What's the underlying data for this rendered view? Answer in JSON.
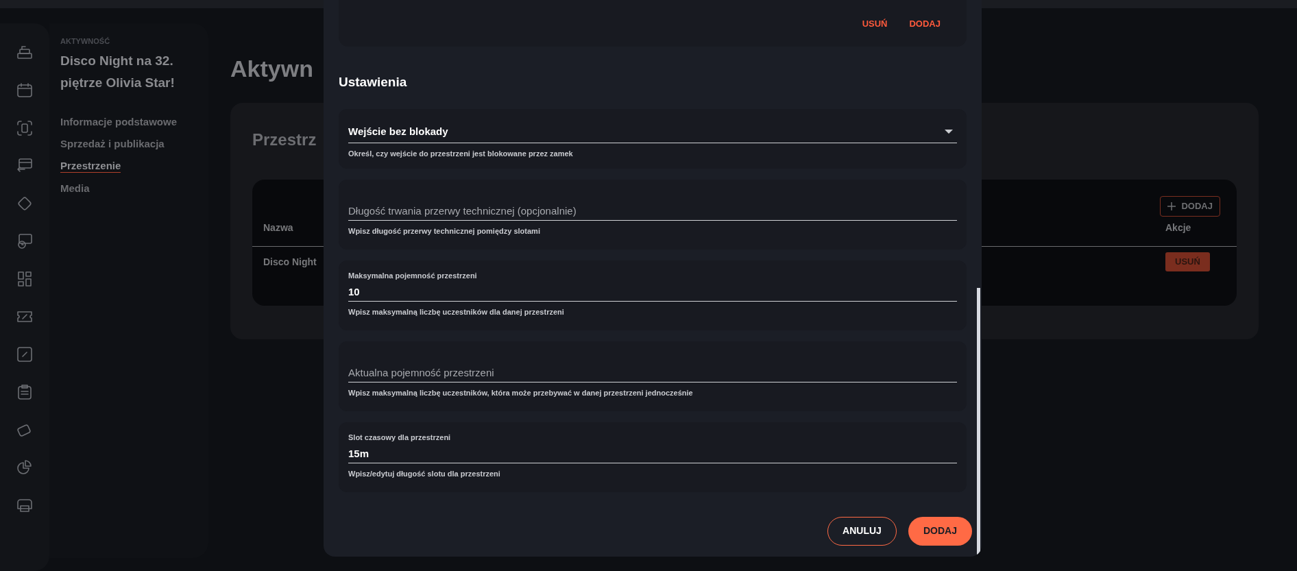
{
  "sidebar": {
    "section_label": "AKTYWNOŚĆ",
    "title": "Disco Night na 32. piętrze Olivia Star!",
    "items": [
      {
        "label": "Informacje podstawowe",
        "selected": false
      },
      {
        "label": "Sprzedaż i publikacja",
        "selected": false
      },
      {
        "label": "Przestrzenie",
        "selected": true
      },
      {
        "label": "Media",
        "selected": false
      }
    ]
  },
  "page": {
    "title": "Aktywn",
    "card_title": "Przestrz",
    "add_button": "DODAJ",
    "table": {
      "columns": [
        "Nazwa",
        "Akcje"
      ],
      "rows": [
        {
          "name": "Disco Night",
          "action": "USUŃ"
        }
      ]
    }
  },
  "modal": {
    "top_actions": [
      "USUŃ",
      "DODAJ"
    ],
    "section_title": "Ustawienia",
    "fields": [
      {
        "kind": "select",
        "value": "Wejście bez blokady",
        "helper": "Określ, czy wejście do przestrzeni jest blokowane przez zamek"
      },
      {
        "kind": "text",
        "placeholder": "Długość trwania przerwy technicznej (opcjonalnie)",
        "helper": "Wpisz długość przerwy technicznej pomiędzy slotami"
      },
      {
        "kind": "text",
        "label": "Maksymalna pojemność przestrzeni",
        "value": "10",
        "helper": "Wpisz maksymalną liczbę uczestników dla danej przestrzeni"
      },
      {
        "kind": "text",
        "placeholder": "Aktualna pojemność przestrzeni",
        "helper": "Wpisz maksymalną liczbę uczestników, która może przebywać w danej przestrzeni jednocześnie"
      },
      {
        "kind": "text",
        "label": "Slot czasowy dla przestrzeni",
        "value": "15m",
        "helper": "Wpisz/edytuj długość slotu dla przestrzeni"
      }
    ],
    "buttons": [
      {
        "label": "ANULUJ",
        "kind": "secondary"
      },
      {
        "label": "DODAJ",
        "kind": "primary"
      }
    ]
  }
}
